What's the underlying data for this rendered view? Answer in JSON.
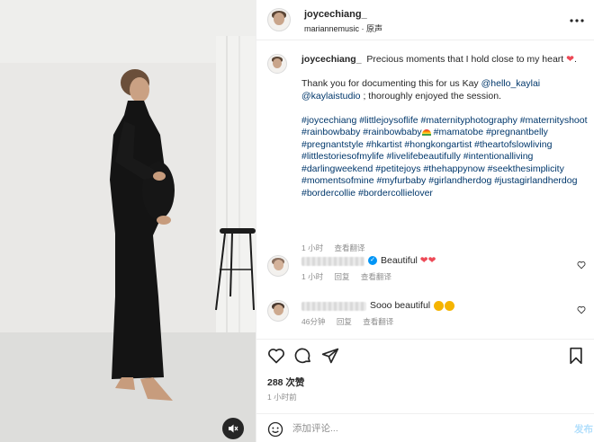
{
  "post": {
    "author": "joycechiang_",
    "audio_credit": "mariannemusic",
    "audio_label": "原声",
    "caption_line1": "Precious moments that I hold close to my heart",
    "caption_p2_a": "Thank you for documenting this for us Kay ",
    "mention1": "@hello_kaylai",
    "mention2": "@kaylaistudio",
    "caption_p2_b": " ; thoroughly enjoyed the session.",
    "hashtags_a": "#joycechiang #littlejoysoflife #maternityphotography #maternityshoot #rainbowbaby #rainbowbaby",
    "hashtags_b": " #mamatobe #pregnantbelly #pregnantstyle #hkartist #hongkongartist #theartofslowliving #littlestoriesofmylife #livelifebeautifully #intentionalliving #darlingweekend #petitejoys #thehappynow #seekthesimplicity #momentsofmine #myfurbaby #girlandherdog #justagirlandherdog #bordercollie #bordercollielover",
    "caption_time": "1 小时",
    "see_translation": "查看翻译",
    "likes": "288 次赞",
    "posted_ago": "1 小时前"
  },
  "comments": [
    {
      "text": "Beautiful",
      "time": "1 小时",
      "reply": "回复",
      "see_translation": "查看翻译"
    },
    {
      "text": "Sooo beautiful",
      "time": "46分钟",
      "reply": "回复",
      "see_translation": "查看翻译"
    }
  ],
  "composer": {
    "placeholder": "添加评论...",
    "post_label": "发布"
  },
  "colors": {
    "link": "#00376b",
    "like_red": "#ed4956",
    "verified": "#0095f6",
    "post_button": "#b2dffc"
  }
}
